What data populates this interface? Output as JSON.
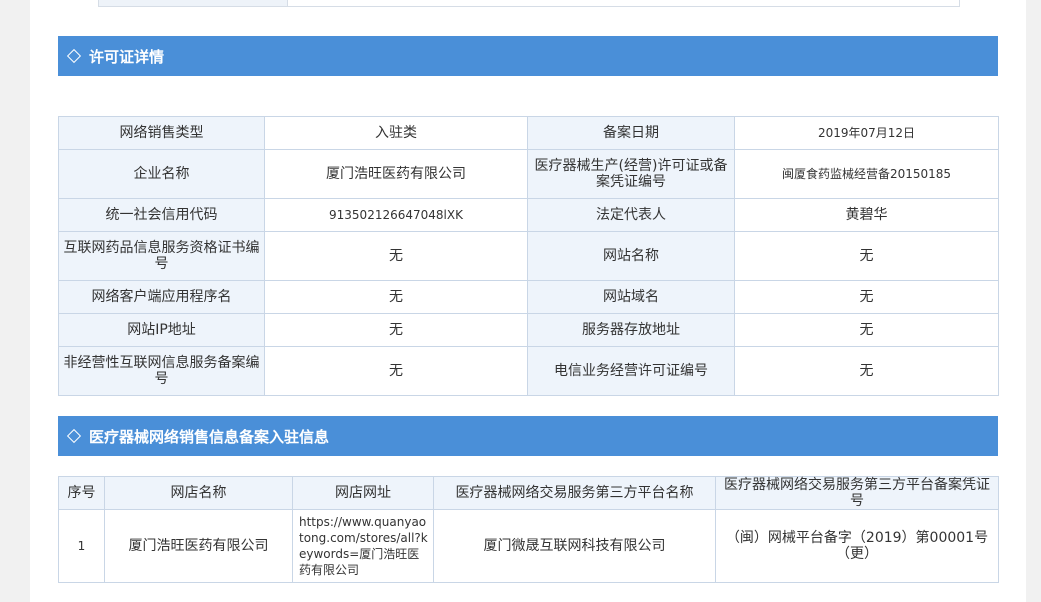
{
  "license_section": {
    "title": "许可证详情",
    "rows": [
      {
        "l1": "网络销售类型",
        "v1": "入驻类",
        "l2": "备案日期",
        "v2": "2019年07月12日"
      },
      {
        "l1": "企业名称",
        "v1": "厦门浩旺医药有限公司",
        "l2": "医疗器械生产(经营)许可证或备案凭证编号",
        "v2": "闽厦食药监械经营备20150185"
      },
      {
        "l1": "统一社会信用代码",
        "v1": "913502126647048lXK",
        "l2": "法定代表人",
        "v2": "黄碧华"
      },
      {
        "l1": "互联网药品信息服务资格证书编号",
        "v1": "无",
        "l2": "网站名称",
        "v2": "无"
      },
      {
        "l1": "网络客户端应用程序名",
        "v1": "无",
        "l2": "网站域名",
        "v2": "无"
      },
      {
        "l1": "网站IP地址",
        "v1": "无",
        "l2": "服务器存放地址",
        "v2": "无"
      },
      {
        "l1": "非经营性互联网信息服务备案编号",
        "v1": "无",
        "l2": "电信业务经营许可证编号",
        "v2": "无"
      }
    ]
  },
  "store_section": {
    "title": "医疗器械网络销售信息备案入驻信息",
    "headers": [
      "序号",
      "网店名称",
      "网店网址",
      "医疗器械网络交易服务第三方平台名称",
      "医疗器械网络交易服务第三方平台备案凭证号"
    ],
    "rows": [
      {
        "index": "1",
        "store_name": "厦门浩旺医药有限公司",
        "store_url": "https://www.quanyaotong.com/stores/all?keywords=厦门浩旺医药有限公司",
        "platform_name": "厦门微晟互联网科技有限公司",
        "platform_cert": "（闽）网械平台备字（2019）第00001号（更）"
      }
    ]
  },
  "colors": {
    "header_bg": "#4a8fd8",
    "label_bg": "#eef4fb",
    "border": "#c9d6e6"
  }
}
